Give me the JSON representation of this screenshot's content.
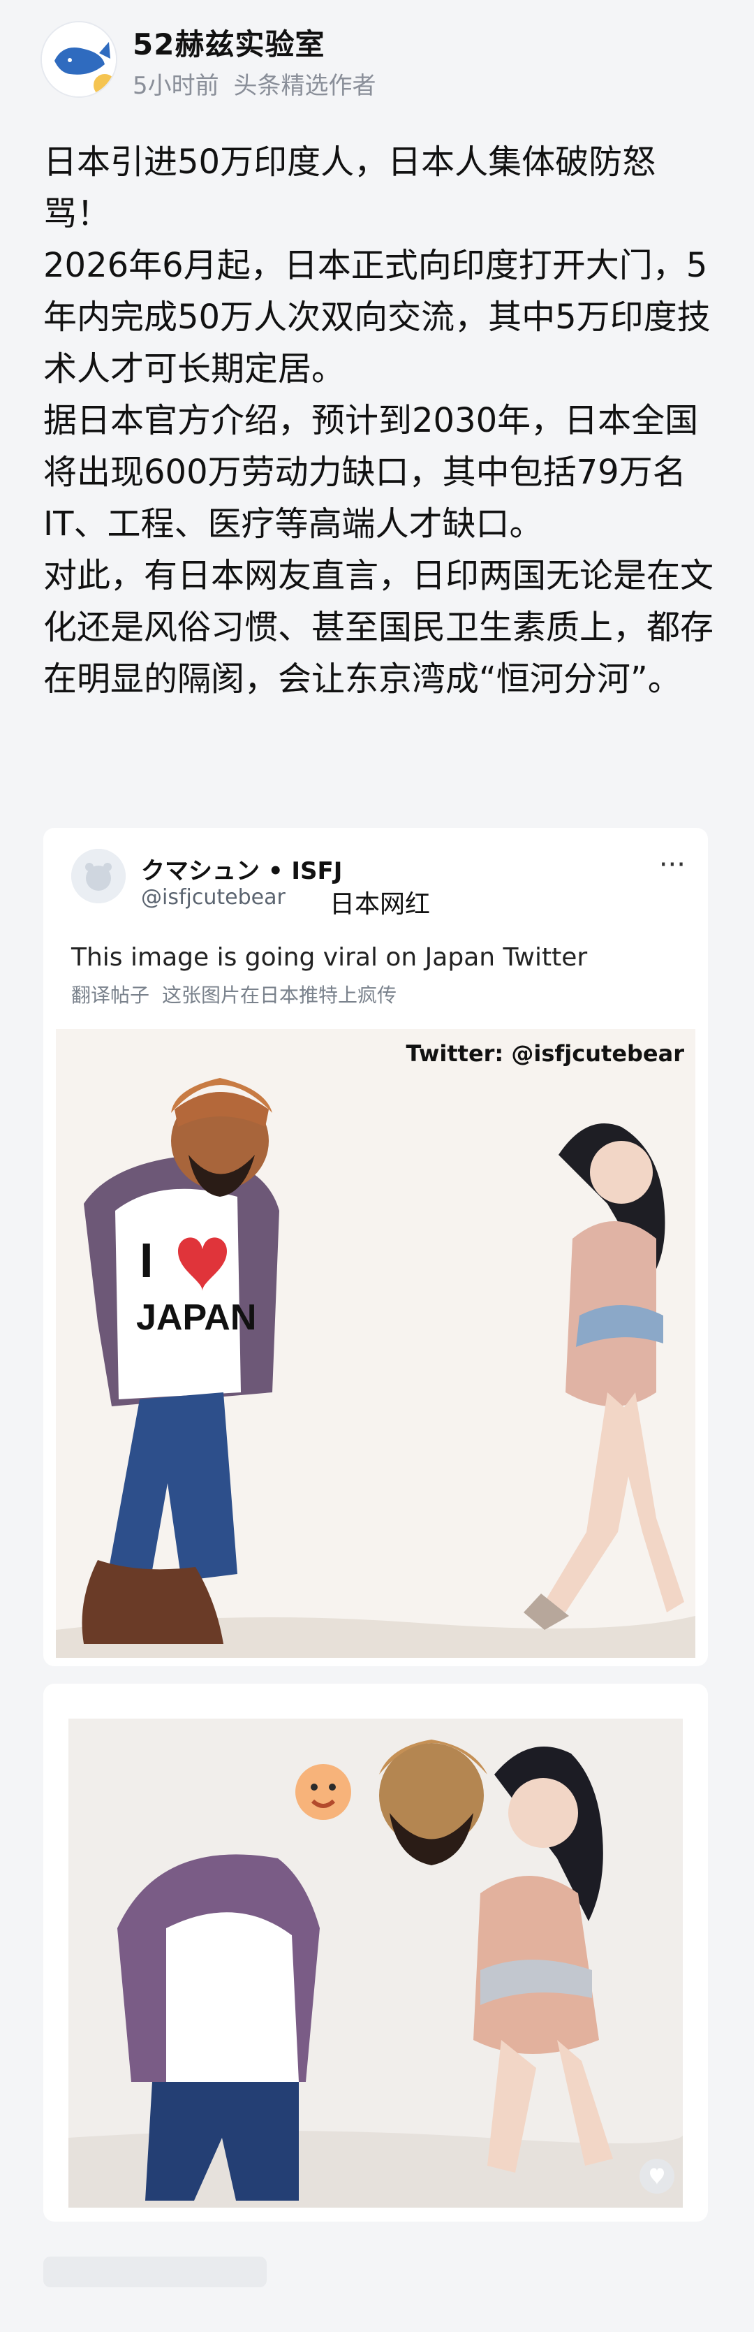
{
  "header": {
    "username": "52赫兹实验室",
    "time": "5小时前",
    "tag": "头条精选作者"
  },
  "post": {
    "title": "日本引进50万印度人，日本人集体破防怒骂！",
    "paragraphs": [
      "2026年6月起，日本正式向印度打开大门，5年内完成50万人次双向交流，其中5万印度技术人才可长期定居。",
      "据日本官方介绍，预计到2030年，日本全国将出现600万劳动力缺口，其中包括79万名IT、工程、医疗等高端人才缺口。",
      "对此，有日本网友直言，日印两国无论是在文化还是风俗习惯、甚至国民卫生素质上，都存在明显的隔阂，会让东京湾成“恒河分河”。"
    ]
  },
  "tweet": {
    "name": "クマシュン • ISFJ",
    "handle": "@isfjcutebear",
    "badge_text": "日本网红",
    "more": "···",
    "text": "This image is going viral on Japan Twitter",
    "translate_label": "翻译帖子",
    "translate_text": "这张图片在日本推特上疯传",
    "watermark": "Twitter: @isfjcutebear",
    "shirt_text": "I ♥ JAPAN"
  },
  "colors": {
    "bg": "#f4f5f7",
    "card": "#ffffff",
    "muted": "#8a8f99",
    "heart": "#e0343a"
  }
}
